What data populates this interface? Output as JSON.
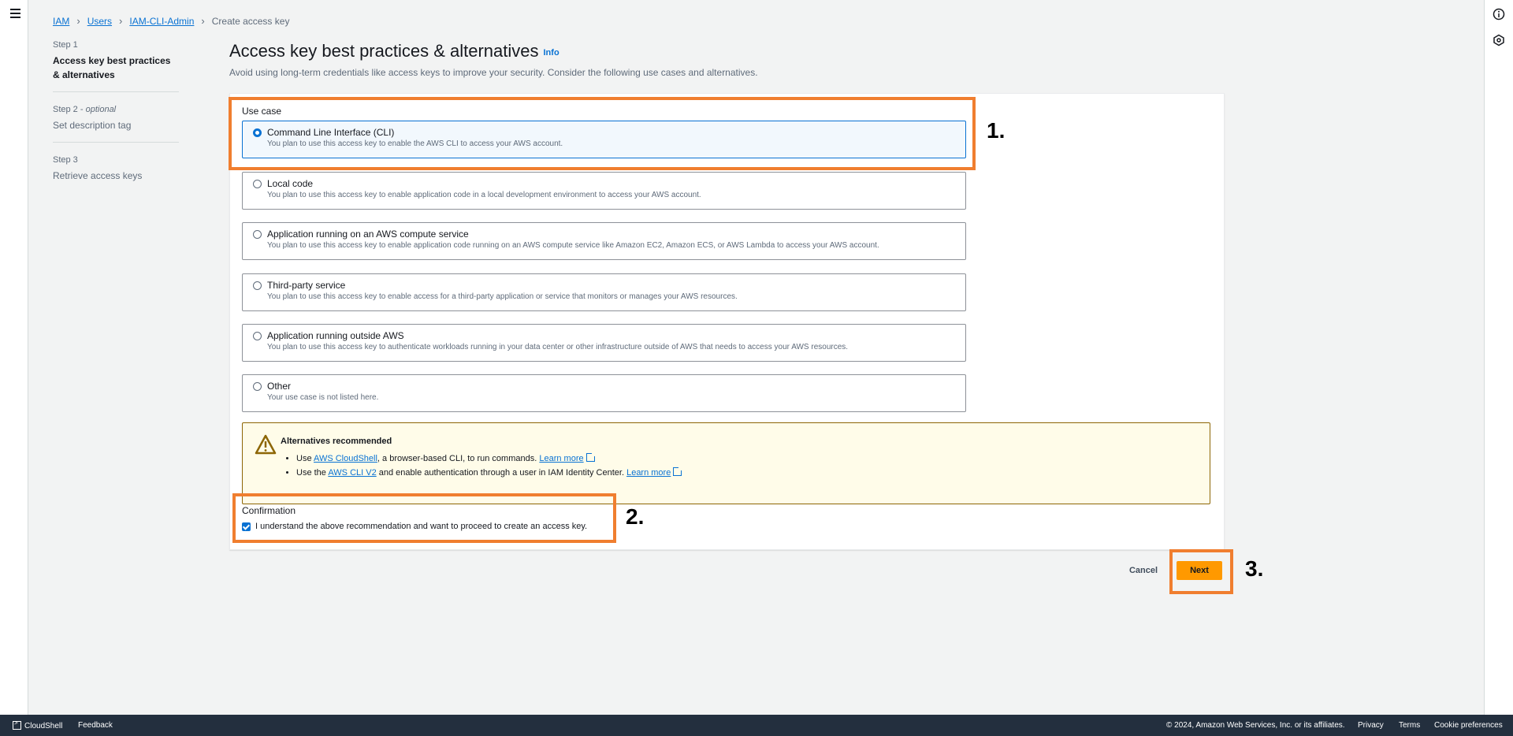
{
  "breadcrumb": {
    "iam": "IAM",
    "users": "Users",
    "user": "IAM-CLI-Admin",
    "current": "Create access key"
  },
  "steps": [
    {
      "num": "Step 1",
      "optional": "",
      "title": "Access key best practices & alternatives"
    },
    {
      "num": "Step 2 -",
      "optional": "optional",
      "title": "Set description tag"
    },
    {
      "num": "Step 3",
      "optional": "",
      "title": "Retrieve access keys"
    }
  ],
  "header": {
    "title": "Access key best practices & alternatives",
    "info": "Info",
    "description": "Avoid using long-term credentials like access keys to improve your security. Consider the following use cases and alternatives."
  },
  "use_case": {
    "label": "Use case",
    "selected": "Command Line Interface (CLI)",
    "options": [
      {
        "title": "Command Line Interface (CLI)",
        "desc": "You plan to use this access key to enable the AWS CLI to access your AWS account."
      },
      {
        "title": "Local code",
        "desc": "You plan to use this access key to enable application code in a local development environment to access your AWS account."
      },
      {
        "title": "Application running on an AWS compute service",
        "desc": "You plan to use this access key to enable application code running on an AWS compute service like Amazon EC2, Amazon ECS, or AWS Lambda to access your AWS account."
      },
      {
        "title": "Third-party service",
        "desc": "You plan to use this access key to enable access for a third-party application or service that monitors or manages your AWS resources."
      },
      {
        "title": "Application running outside AWS",
        "desc": "You plan to use this access key to authenticate workloads running in your data center or other infrastructure outside of AWS that needs to access your AWS resources."
      },
      {
        "title": "Other",
        "desc": "Your use case is not listed here."
      }
    ]
  },
  "alert": {
    "title": "Alternatives recommended",
    "item1": {
      "pre": "Use ",
      "link": "AWS CloudShell",
      "mid": ", a browser-based CLI, to run commands. ",
      "learn": "Learn more"
    },
    "item2": {
      "pre": "Use the ",
      "link": "AWS CLI V2",
      "mid": " and enable authentication through a user in IAM Identity Center. ",
      "learn": "Learn more"
    }
  },
  "confirmation": {
    "label": "Confirmation",
    "text": "I understand the above recommendation and want to proceed to create an access key.",
    "checked": true
  },
  "actions": {
    "cancel": "Cancel",
    "next": "Next"
  },
  "annotations": {
    "a1": "1.",
    "a2": "2.",
    "a3": "3."
  },
  "footer": {
    "cloudshell": "CloudShell",
    "feedback": "Feedback",
    "copyright": "© 2024, Amazon Web Services, Inc. or its affiliates.",
    "privacy": "Privacy",
    "terms": "Terms",
    "cookies": "Cookie preferences"
  },
  "colors": {
    "accent": "#0972d3",
    "primary_button": "#ff9900",
    "highlight": "#f07e2f",
    "footer_bg": "#232f3e"
  }
}
